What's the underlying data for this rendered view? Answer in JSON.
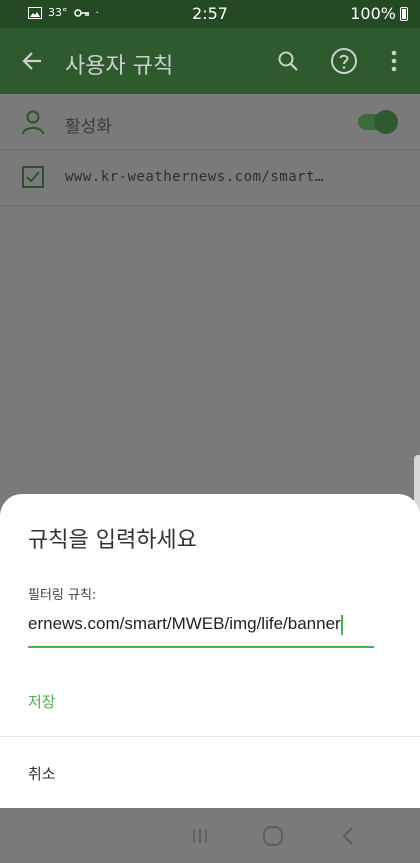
{
  "status_bar": {
    "temperature": "33°",
    "dot": "·",
    "time": "2:57",
    "battery": "100%"
  },
  "app_bar": {
    "title": "사용자 규칙"
  },
  "rules": {
    "enable_label": "활성화",
    "rule_url": "www.kr-weathernews.com/smart…"
  },
  "dialog": {
    "title": "규칙을 입력하세요",
    "field_label": "필터링 규칙:",
    "field_value": "ernews.com/smart/MWEB/img/life/banner",
    "save_label": "저장",
    "cancel_label": "취소"
  },
  "colors": {
    "accent": "#4caf50",
    "app_bar": "#2e5a2e",
    "status_bar": "#234a23"
  }
}
